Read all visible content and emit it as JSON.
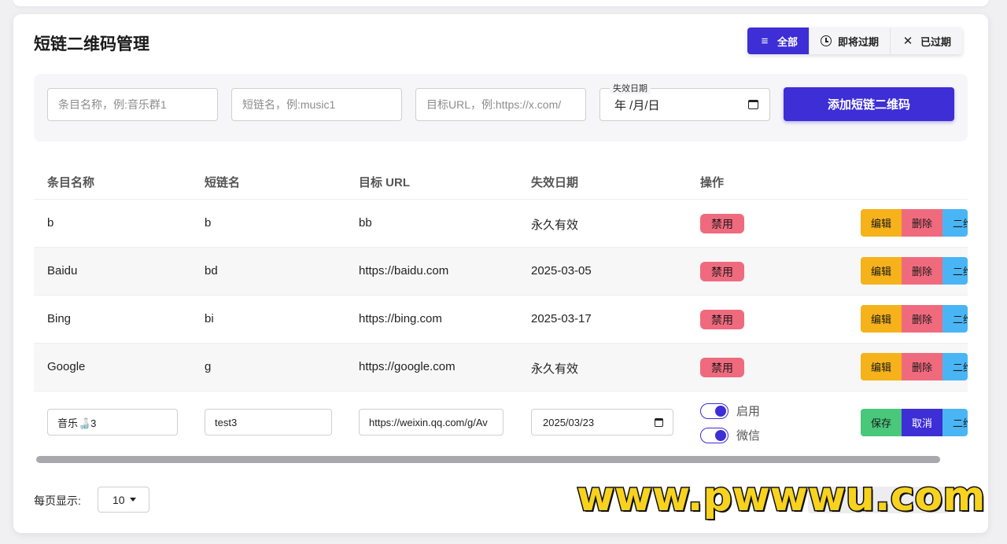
{
  "page": {
    "title": "短链二维码管理"
  },
  "filters": [
    {
      "label": "全部",
      "icon": "menu-lines-icon",
      "active": true
    },
    {
      "label": "即将过期",
      "icon": "clock-icon",
      "active": false
    },
    {
      "label": "已过期",
      "icon": "close-icon",
      "active": false
    }
  ],
  "form": {
    "name_placeholder": "条目名称，例:音乐群1",
    "short_placeholder": "短链名，例:music1",
    "url_placeholder": "目标URL，例:https://x.com/",
    "date_legend": "失效日期",
    "date_value": "年 /月/日",
    "add_label": "添加短链二维码"
  },
  "table": {
    "headers": [
      "条目名称",
      "短链名",
      "目标 URL",
      "失效日期",
      "操作"
    ],
    "rows": [
      {
        "name": "b",
        "short": "b",
        "url": "bb",
        "expire": "永久有效",
        "status": "禁用"
      },
      {
        "name": "Baidu",
        "short": "bd",
        "url": "https://baidu.com",
        "expire": "2025-03-05",
        "status": "禁用"
      },
      {
        "name": "Bing",
        "short": "bi",
        "url": "https://bing.com",
        "expire": "2025-03-17",
        "status": "禁用"
      },
      {
        "name": "Google",
        "short": "g",
        "url": "https://google.com",
        "expire": "永久有效",
        "status": "禁用"
      }
    ],
    "actions": {
      "edit": "编辑",
      "delete": "删除",
      "qr": "二维",
      "save": "保存",
      "cancel": "取消"
    },
    "edit_row": {
      "name": "音乐🍶3",
      "short": "test3",
      "url": "https://weixin.qq.com/g/Av",
      "expire": "2025/03/23",
      "toggle_enable": "启用",
      "toggle_wechat": "微信"
    }
  },
  "footer": {
    "per_page_label": "每页显示:",
    "per_page_value": "10"
  },
  "watermark": "www.pwwwu.com",
  "colors": {
    "accent": "#3d2ed6",
    "edit": "#f5b21a",
    "danger": "#f06a7e",
    "info": "#4ab5f5",
    "success": "#49c77a"
  }
}
